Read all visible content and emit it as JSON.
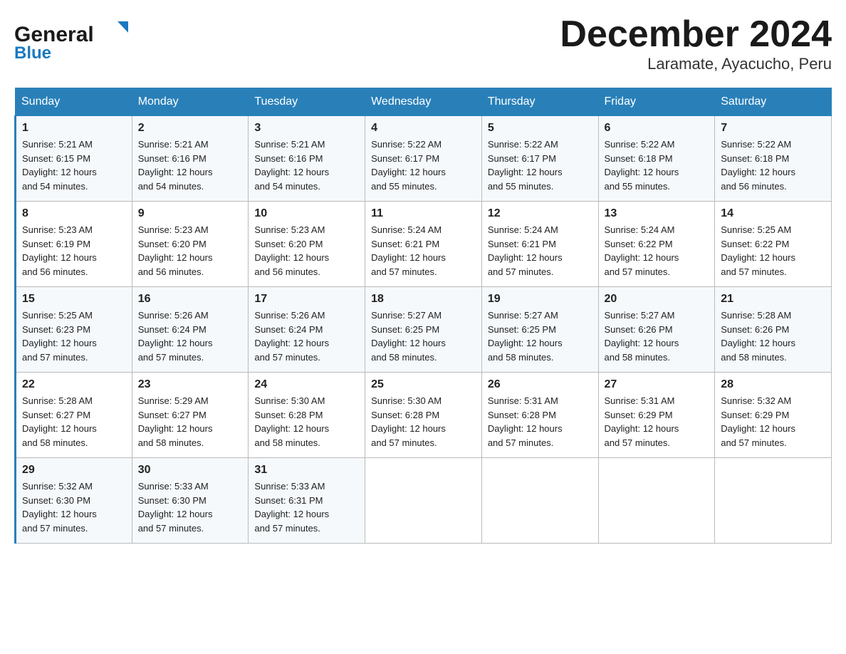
{
  "header": {
    "logo_general": "General",
    "logo_blue": "Blue",
    "title": "December 2024",
    "subtitle": "Laramate, Ayacucho, Peru"
  },
  "days_of_week": [
    "Sunday",
    "Monday",
    "Tuesday",
    "Wednesday",
    "Thursday",
    "Friday",
    "Saturday"
  ],
  "weeks": [
    [
      {
        "day": "1",
        "sunrise": "5:21 AM",
        "sunset": "6:15 PM",
        "daylight": "12 hours and 54 minutes."
      },
      {
        "day": "2",
        "sunrise": "5:21 AM",
        "sunset": "6:16 PM",
        "daylight": "12 hours and 54 minutes."
      },
      {
        "day": "3",
        "sunrise": "5:21 AM",
        "sunset": "6:16 PM",
        "daylight": "12 hours and 54 minutes."
      },
      {
        "day": "4",
        "sunrise": "5:22 AM",
        "sunset": "6:17 PM",
        "daylight": "12 hours and 55 minutes."
      },
      {
        "day": "5",
        "sunrise": "5:22 AM",
        "sunset": "6:17 PM",
        "daylight": "12 hours and 55 minutes."
      },
      {
        "day": "6",
        "sunrise": "5:22 AM",
        "sunset": "6:18 PM",
        "daylight": "12 hours and 55 minutes."
      },
      {
        "day": "7",
        "sunrise": "5:22 AM",
        "sunset": "6:18 PM",
        "daylight": "12 hours and 56 minutes."
      }
    ],
    [
      {
        "day": "8",
        "sunrise": "5:23 AM",
        "sunset": "6:19 PM",
        "daylight": "12 hours and 56 minutes."
      },
      {
        "day": "9",
        "sunrise": "5:23 AM",
        "sunset": "6:20 PM",
        "daylight": "12 hours and 56 minutes."
      },
      {
        "day": "10",
        "sunrise": "5:23 AM",
        "sunset": "6:20 PM",
        "daylight": "12 hours and 56 minutes."
      },
      {
        "day": "11",
        "sunrise": "5:24 AM",
        "sunset": "6:21 PM",
        "daylight": "12 hours and 57 minutes."
      },
      {
        "day": "12",
        "sunrise": "5:24 AM",
        "sunset": "6:21 PM",
        "daylight": "12 hours and 57 minutes."
      },
      {
        "day": "13",
        "sunrise": "5:24 AM",
        "sunset": "6:22 PM",
        "daylight": "12 hours and 57 minutes."
      },
      {
        "day": "14",
        "sunrise": "5:25 AM",
        "sunset": "6:22 PM",
        "daylight": "12 hours and 57 minutes."
      }
    ],
    [
      {
        "day": "15",
        "sunrise": "5:25 AM",
        "sunset": "6:23 PM",
        "daylight": "12 hours and 57 minutes."
      },
      {
        "day": "16",
        "sunrise": "5:26 AM",
        "sunset": "6:24 PM",
        "daylight": "12 hours and 57 minutes."
      },
      {
        "day": "17",
        "sunrise": "5:26 AM",
        "sunset": "6:24 PM",
        "daylight": "12 hours and 57 minutes."
      },
      {
        "day": "18",
        "sunrise": "5:27 AM",
        "sunset": "6:25 PM",
        "daylight": "12 hours and 58 minutes."
      },
      {
        "day": "19",
        "sunrise": "5:27 AM",
        "sunset": "6:25 PM",
        "daylight": "12 hours and 58 minutes."
      },
      {
        "day": "20",
        "sunrise": "5:27 AM",
        "sunset": "6:26 PM",
        "daylight": "12 hours and 58 minutes."
      },
      {
        "day": "21",
        "sunrise": "5:28 AM",
        "sunset": "6:26 PM",
        "daylight": "12 hours and 58 minutes."
      }
    ],
    [
      {
        "day": "22",
        "sunrise": "5:28 AM",
        "sunset": "6:27 PM",
        "daylight": "12 hours and 58 minutes."
      },
      {
        "day": "23",
        "sunrise": "5:29 AM",
        "sunset": "6:27 PM",
        "daylight": "12 hours and 58 minutes."
      },
      {
        "day": "24",
        "sunrise": "5:30 AM",
        "sunset": "6:28 PM",
        "daylight": "12 hours and 58 minutes."
      },
      {
        "day": "25",
        "sunrise": "5:30 AM",
        "sunset": "6:28 PM",
        "daylight": "12 hours and 57 minutes."
      },
      {
        "day": "26",
        "sunrise": "5:31 AM",
        "sunset": "6:28 PM",
        "daylight": "12 hours and 57 minutes."
      },
      {
        "day": "27",
        "sunrise": "5:31 AM",
        "sunset": "6:29 PM",
        "daylight": "12 hours and 57 minutes."
      },
      {
        "day": "28",
        "sunrise": "5:32 AM",
        "sunset": "6:29 PM",
        "daylight": "12 hours and 57 minutes."
      }
    ],
    [
      {
        "day": "29",
        "sunrise": "5:32 AM",
        "sunset": "6:30 PM",
        "daylight": "12 hours and 57 minutes."
      },
      {
        "day": "30",
        "sunrise": "5:33 AM",
        "sunset": "6:30 PM",
        "daylight": "12 hours and 57 minutes."
      },
      {
        "day": "31",
        "sunrise": "5:33 AM",
        "sunset": "6:31 PM",
        "daylight": "12 hours and 57 minutes."
      },
      null,
      null,
      null,
      null
    ]
  ],
  "labels": {
    "sunrise": "Sunrise:",
    "sunset": "Sunset:",
    "daylight": "Daylight:"
  }
}
